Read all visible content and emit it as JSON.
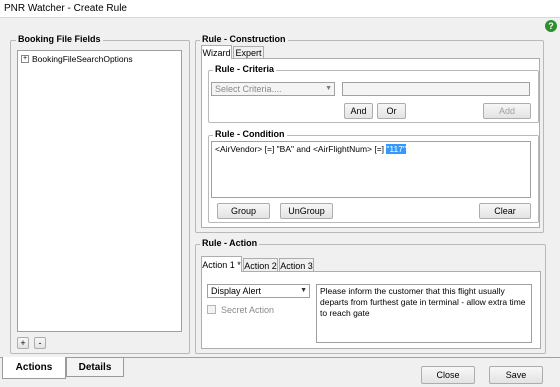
{
  "window": {
    "title": "PNR Watcher - Create Rule",
    "help_glyph": "?"
  },
  "booking": {
    "group_label": "Booking File Fields",
    "tree": [
      {
        "expander": "+",
        "label": "BookingFileSearchOptions"
      }
    ],
    "add_label": "+",
    "remove_label": "-"
  },
  "construction": {
    "group_label": "Rule - Construction",
    "tabs": [
      "Wizard",
      "Expert"
    ],
    "criteria": {
      "label": "Rule - Criteria",
      "select_placeholder": "Select Criteria....",
      "value_field": "",
      "and_label": "And",
      "or_label": "Or",
      "add_label": "Add"
    },
    "condition": {
      "label": "Rule - Condition",
      "text_prefix": "<AirVendor> [=] \"BA\" and <AirFlightNum> [=] ",
      "text_selected": "\"117\"",
      "group_label": "Group",
      "ungroup_label": "UnGroup",
      "clear_label": "Clear"
    }
  },
  "action": {
    "group_label": "Rule - Action",
    "tabs": [
      "Action 1 *",
      "Action 2",
      "Action 3"
    ],
    "type_value": "Display Alert",
    "secret_label": "Secret Action",
    "message": "Please inform the customer that this flight usually departs from furthest gate in terminal - allow extra time to reach gate"
  },
  "bottom_tabs": [
    "Actions",
    "Details"
  ],
  "buttons": {
    "close": "Close",
    "save": "Save"
  }
}
